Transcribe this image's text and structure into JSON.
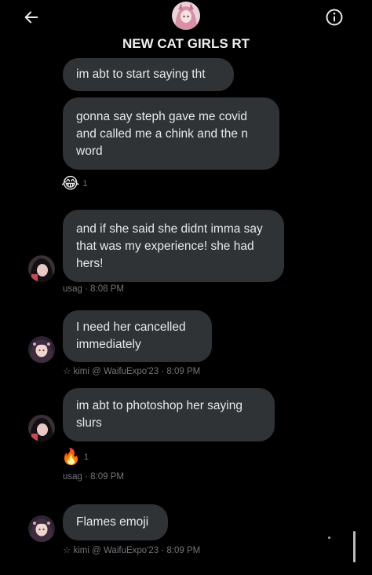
{
  "header": {
    "title": "NEW CAT GIRLS RT",
    "back_icon": "arrow-left-icon",
    "info_icon": "info-icon"
  },
  "messages": [
    {
      "text": "im abt to start saying tht"
    },
    {
      "text": "gonna say steph gave me covid and called me a chink and the n word",
      "reaction": {
        "emoji": "😂",
        "count": "1"
      }
    },
    {
      "text": "and if she said she didnt imma say that was my experience! she had hers!",
      "meta": "usag · 8:08 PM"
    },
    {
      "text": "I need her cancelled immediately",
      "meta": "☆ kimi @ WaifuExpo'23 · 8:09 PM"
    },
    {
      "text": "im abt to photoshop her saying slurs",
      "reaction": {
        "emoji": "🔥",
        "count": "1"
      },
      "meta": "usag · 8:09 PM"
    },
    {
      "text": "Flames emoji",
      "meta": "☆ kimi @ WaifuExpo'23 · 8:09 PM"
    }
  ],
  "colors": {
    "background": "#000000",
    "bubble": "#2f3336",
    "text": "#e7e9ea",
    "meta": "#71767b"
  }
}
